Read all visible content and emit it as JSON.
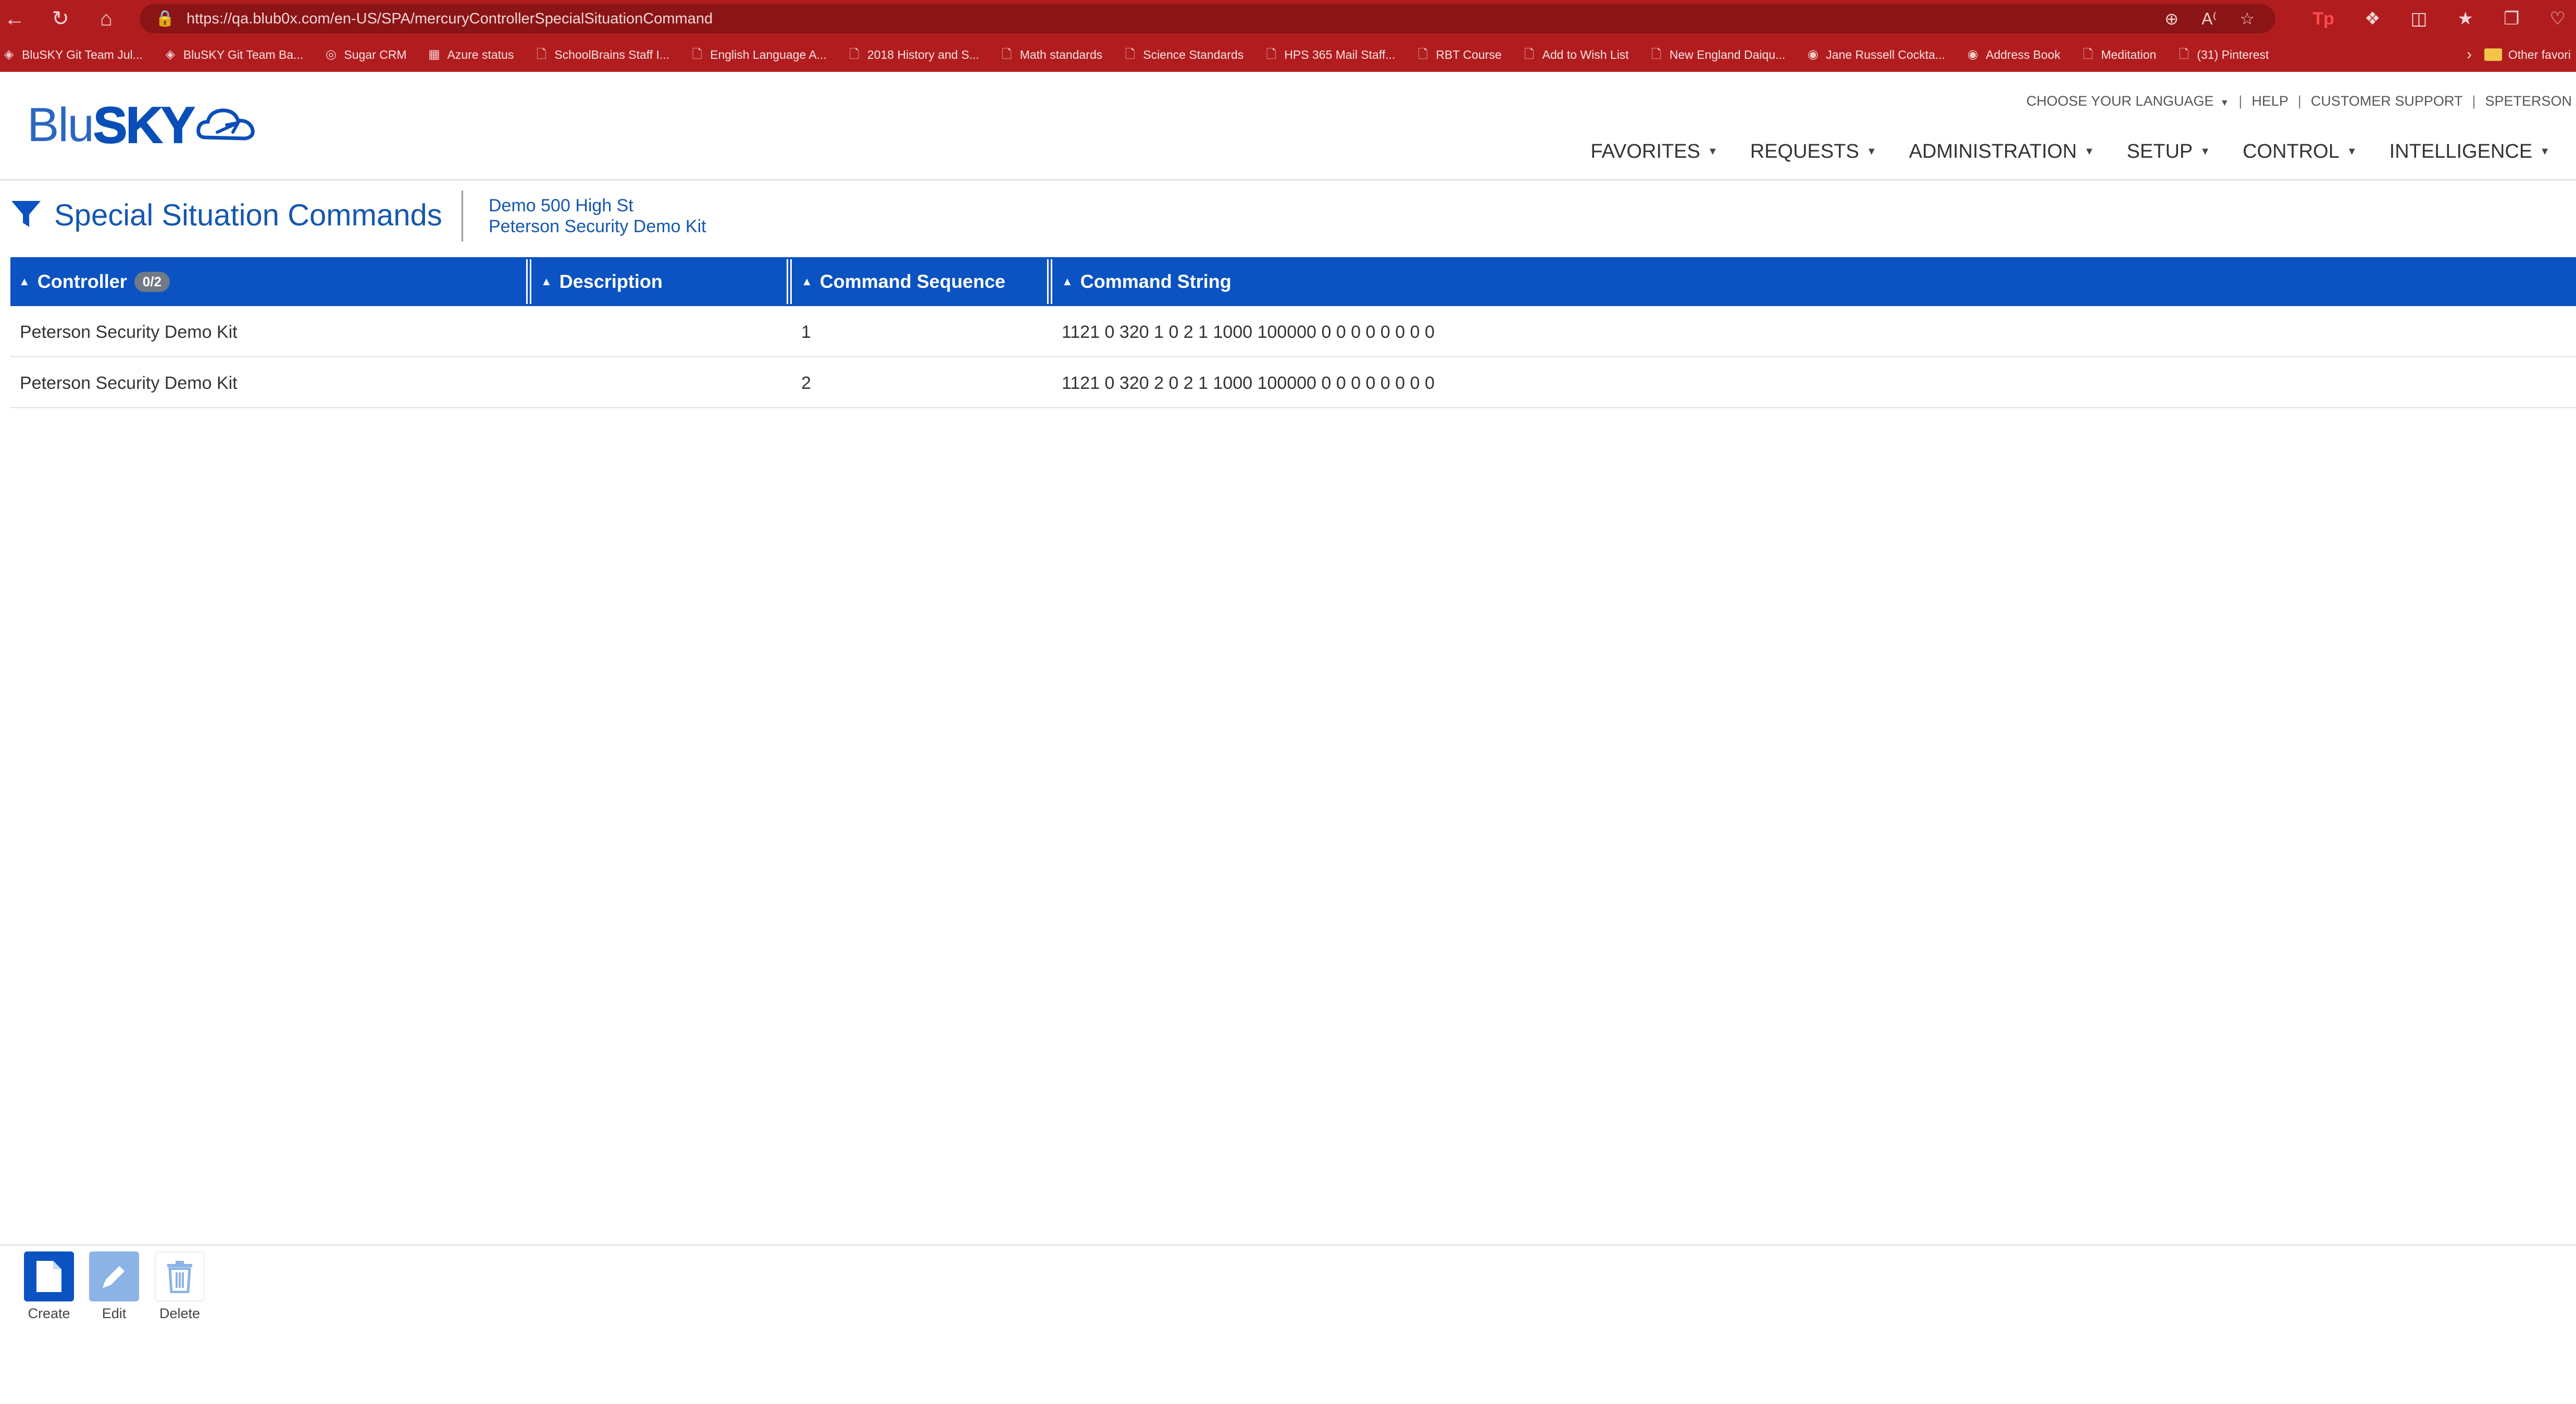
{
  "browser": {
    "url": "https://qa.blub0x.com/en-US/SPA/mercuryControllerSpecialSituationCommand",
    "bookmarks": [
      {
        "label": "BluSKY Git Team Jul...",
        "icon": "git-icon"
      },
      {
        "label": "BluSKY Git Team Ba...",
        "icon": "git-icon"
      },
      {
        "label": "Sugar CRM",
        "icon": "sugar-icon"
      },
      {
        "label": "Azure status",
        "icon": "microsoft-icon"
      },
      {
        "label": "SchoolBrains Staff I...",
        "icon": "page-icon"
      },
      {
        "label": "English Language A...",
        "icon": "page-icon"
      },
      {
        "label": "2018 History and S...",
        "icon": "page-icon"
      },
      {
        "label": "Math standards",
        "icon": "page-icon"
      },
      {
        "label": "Science Standards",
        "icon": "page-icon"
      },
      {
        "label": "HPS 365 Mail Staff...",
        "icon": "page-icon"
      },
      {
        "label": "RBT Course",
        "icon": "page-icon"
      },
      {
        "label": "Add to Wish List",
        "icon": "page-icon"
      },
      {
        "label": "New England Daiqu...",
        "icon": "page-icon"
      },
      {
        "label": "Jane Russell Cockta...",
        "icon": "globe-icon"
      },
      {
        "label": "Address Book",
        "icon": "globe-icon"
      },
      {
        "label": "Meditation",
        "icon": "page-icon"
      },
      {
        "label": "(31) Pinterest",
        "icon": "page-icon"
      }
    ],
    "other_favorites": "Other favori"
  },
  "logo": {
    "blu": "Blu",
    "sky": "SKY"
  },
  "util_links": {
    "language": "CHOOSE YOUR LANGUAGE",
    "help": "HELP",
    "support": "CUSTOMER SUPPORT",
    "user": "SPETERSON",
    "separator": "|"
  },
  "nav": [
    "FAVORITES",
    "REQUESTS",
    "ADMINISTRATION",
    "SETUP",
    "CONTROL",
    "INTELLIGENCE"
  ],
  "page": {
    "title": "Special Situation Commands",
    "context_line1": "Demo 500 High St",
    "context_line2": "Peterson Security Demo Kit"
  },
  "table": {
    "columns": {
      "controller": "Controller",
      "controller_badge": "0/2",
      "description": "Description",
      "sequence": "Command Sequence",
      "command": "Command String"
    },
    "rows": [
      {
        "controller": "Peterson Security Demo Kit",
        "description": "",
        "sequence": "1",
        "command": "1121 0 320 1 0 2 1 1000 100000 0 0 0 0 0 0 0 0"
      },
      {
        "controller": "Peterson Security Demo Kit",
        "description": "",
        "sequence": "2",
        "command": "1121 0 320 2 0 2 1 1000 100000 0 0 0 0 0 0 0 0"
      }
    ]
  },
  "toolbar": {
    "create": "Create",
    "edit": "Edit",
    "delete": "Delete"
  },
  "colors": {
    "chrome": "#b11d1f",
    "brand": "#0b52c2",
    "title": "#1557b0"
  }
}
